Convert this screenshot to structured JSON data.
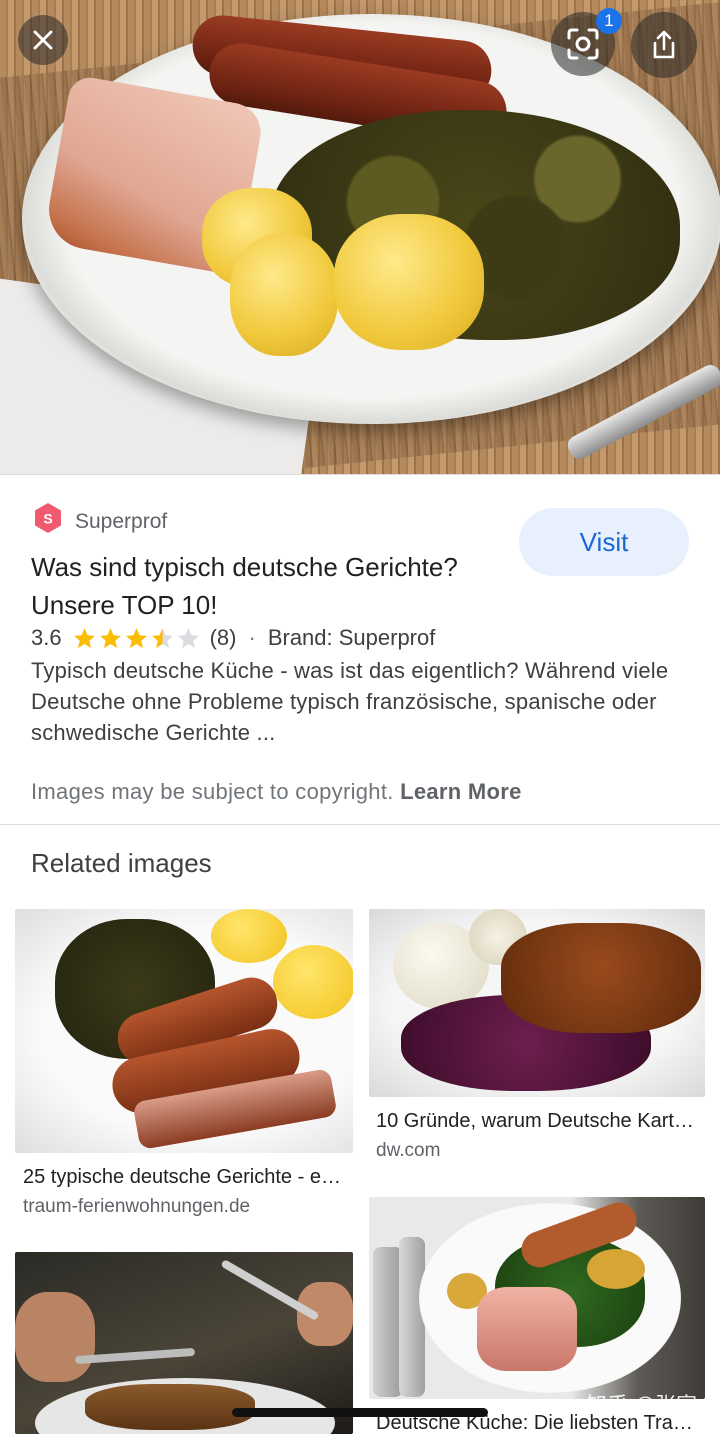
{
  "hero": {
    "alt": "Plate with sausages, smoked pork, kale and potatoes"
  },
  "top_controls": {
    "close_icon": "close-icon",
    "lens_icon": "lens-icon",
    "lens_badge": "1",
    "share_icon": "share-icon"
  },
  "result": {
    "source_logo_letter": "S",
    "source_name": "Superprof",
    "visit_label": "Visit",
    "title": "Was sind typisch deutsche Gerichte? Unsere TOP 10!",
    "rating_value": "3.6",
    "rating_fraction": 0.72,
    "rating_count": "(8)",
    "separator": "·",
    "brand": "Brand: Superprof",
    "description": "Typisch deutsche Küche - was ist das eigentlich? Während viele Deutsche ohne Probleme typisch französische, spanische oder schwedische Gerichte ...",
    "copyright_text": "Images may be subject to copyright.",
    "learn_more": "Learn More"
  },
  "related": {
    "heading": "Related images",
    "items": [
      {
        "title": "25 typische deutsche Gerichte - ei…",
        "source": "traum-ferienwohnungen.de"
      },
      {
        "title": "10 Gründe, warum Deutsche Karto…",
        "source": "dw.com"
      },
      {
        "title": "",
        "source": ""
      },
      {
        "title": "Deutsche Küche: Die liebsten Trad…",
        "source": ""
      }
    ]
  },
  "watermark": "知乎 @张宣",
  "colors": {
    "accent": "#1967d2",
    "star": "#fbbc04",
    "logo": "#ef5a6f"
  }
}
